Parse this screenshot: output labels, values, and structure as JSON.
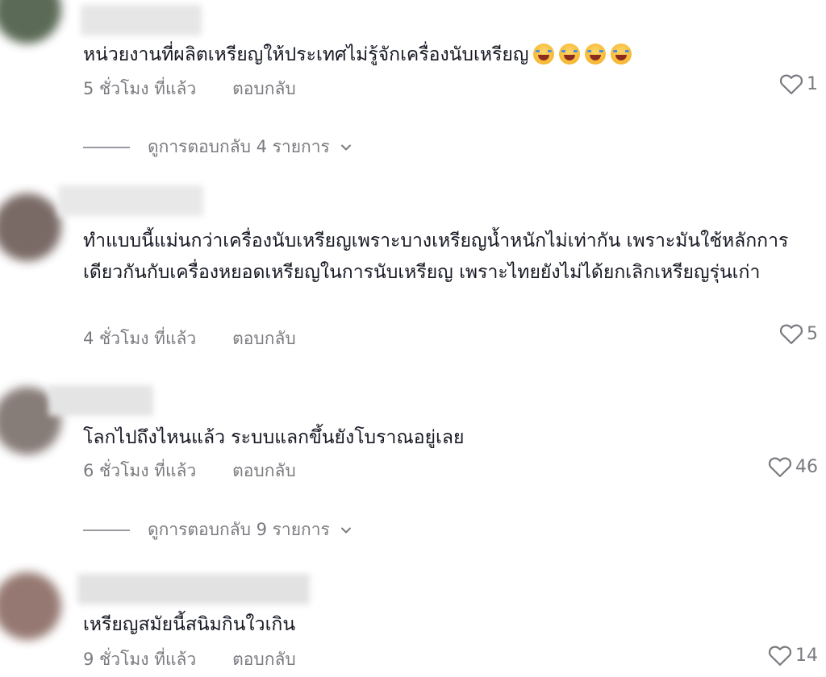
{
  "comments": [
    {
      "text": "หน่วยงานที่ผลิตเหรียญให้ประเทศไม่รู้จักเครื่องนับเหรียญ",
      "emoji": [
        "face-with-tears-of-joy-icon",
        "face-with-tears-of-joy-icon",
        "face-with-tears-of-joy-icon",
        "face-with-tears-of-joy-icon"
      ],
      "time": "5 ชั่วโมง ที่แล้ว",
      "reply": "ตอบกลับ",
      "likes": "1",
      "view_replies": "ดูการตอบกลับ 4 รายการ"
    },
    {
      "text": "ทำแบบนี้แม่นกว่าเครื่องนับเหรียญเพราะบางเหรียญน้ำหนักไม่เท่ากัน เพราะมันใช้หลักการเดียวกันกับเครื่องหยอดเหรียญในการนับเหรียญ เพราะไทยยังไม่ได้ยกเลิกเหรียญรุ่นเก่า",
      "time": "4 ชั่วโมง ที่แล้ว",
      "reply": "ตอบกลับ",
      "likes": "5"
    },
    {
      "text": "โลกไปถึงไหนแล้ว ระบบแลกขึ้นยังโบราณอยู่เลย",
      "time": "6 ชั่วโมง ที่แล้ว",
      "reply": "ตอบกลับ",
      "likes": "46",
      "view_replies": "ดูการตอบกลับ 9 รายการ"
    },
    {
      "text": "เหรียญสมัยนี้สนิมกินใวเกิน",
      "time": "9 ชั่วโมง ที่แล้ว",
      "reply": "ตอบกลับ",
      "likes": "14"
    }
  ],
  "colors": {
    "text": "#161823",
    "meta": "#7a7b80",
    "background": "#ffffff"
  }
}
